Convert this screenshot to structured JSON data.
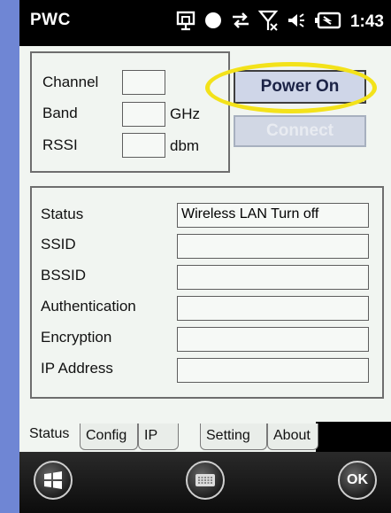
{
  "statusbar": {
    "title": "PWC",
    "time": "1:43",
    "icons": [
      "sync-window-icon",
      "status-dot-icon",
      "data-arrows-icon",
      "no-signal-icon",
      "speaker-icon",
      "battery-icon"
    ]
  },
  "radio": {
    "channel_label": "Channel",
    "band_label": "Band",
    "rssi_label": "RSSI",
    "channel_value": "",
    "band_value": "",
    "rssi_value": "",
    "band_unit": "GHz",
    "rssi_unit": "dbm"
  },
  "buttons": {
    "power": "Power On",
    "connect": "Connect"
  },
  "info": {
    "status_label": "Status",
    "status_value": "Wireless LAN Turn off",
    "ssid_label": "SSID",
    "ssid_value": "",
    "bssid_label": "BSSID",
    "bssid_value": "",
    "auth_label": "Authentication",
    "auth_value": "",
    "enc_label": "Encryption",
    "enc_value": "",
    "ip_label": "IP Address",
    "ip_value": ""
  },
  "tabs": [
    {
      "label": "Status",
      "active": true
    },
    {
      "label": "Config",
      "active": false
    },
    {
      "label": "IP",
      "active": false
    },
    {
      "label": "Setting",
      "active": false
    },
    {
      "label": "About",
      "active": false
    }
  ],
  "softkeys": {
    "start_icon": "windows-start-icon",
    "keyboard_icon": "keyboard-icon",
    "ok_label": "OK"
  },
  "colors": {
    "highlight": "#f3e21a",
    "frame": "#6f86d4"
  }
}
